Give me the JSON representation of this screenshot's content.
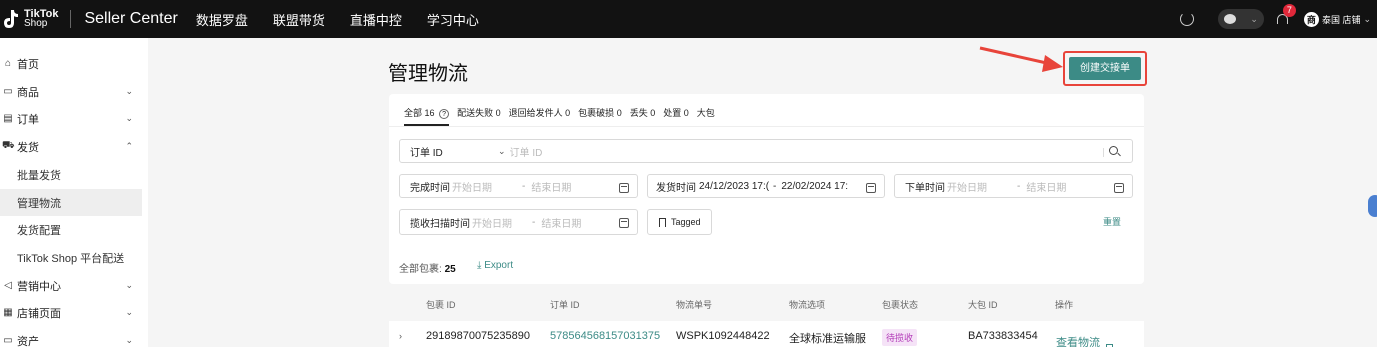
{
  "topbar": {
    "logo_line1": "TikTok",
    "logo_line2": "Shop",
    "brand": "Seller Center",
    "nav": [
      "数据罗盘",
      "联盟带货",
      "直播中控",
      "学习中心"
    ],
    "notification_count": "7",
    "store_initial": "商",
    "store_name": "泰国 店铺"
  },
  "sidebar": {
    "items": [
      {
        "label": "首页",
        "icon": "home-icon"
      },
      {
        "label": "商品",
        "icon": "product-icon"
      },
      {
        "label": "订单",
        "icon": "order-icon"
      },
      {
        "label": "发货",
        "icon": "shipping-icon"
      },
      {
        "label": "批量发货"
      },
      {
        "label": "管理物流"
      },
      {
        "label": "发货配置"
      },
      {
        "label": "TikTok Shop 平台配送"
      },
      {
        "label": "营销中心",
        "icon": "marketing-icon"
      },
      {
        "label": "店铺页面",
        "icon": "store-icon"
      },
      {
        "label": "资产",
        "icon": "asset-icon"
      }
    ]
  },
  "main": {
    "title": "管理物流",
    "create_button": "创建交接单",
    "tabs": [
      {
        "label": "全部",
        "count": "16"
      },
      {
        "label": "配送失败",
        "count": "0"
      },
      {
        "label": "退回给发件人",
        "count": "0"
      },
      {
        "label": "包裹破损",
        "count": "0"
      },
      {
        "label": "丢失",
        "count": "0"
      },
      {
        "label": "处置",
        "count": "0"
      },
      {
        "label": "大包",
        "count": ""
      }
    ],
    "search": {
      "select": "订单 ID",
      "placeholder": "订单 ID"
    },
    "filters": {
      "complete_label": "完成时间",
      "start_ph": "开始日期",
      "end_ph": "结束日期",
      "ship_label": "发货时间",
      "ship_start": "24/12/2023 17:(",
      "ship_end": "22/02/2024 17:",
      "order_label": "下单时间",
      "scan_label": "揽收扫描时间",
      "tagged": "Tagged",
      "dash": "-",
      "reset": "重置"
    },
    "total_label": "全部包裹:",
    "total_count": "25",
    "export": "Export"
  },
  "table": {
    "headers": [
      "包裹 ID",
      "订单 ID",
      "物流单号",
      "物流选项",
      "包裹状态",
      "大包 ID",
      "操作"
    ],
    "rows": [
      {
        "package_id": "29189870075235890",
        "order_id": "578564568157031375",
        "tracking": "WSPK1092448422",
        "option": "全球标准运输服",
        "status": "待揽收",
        "bag_id": "BA733833454",
        "action": "查看物流"
      }
    ]
  }
}
